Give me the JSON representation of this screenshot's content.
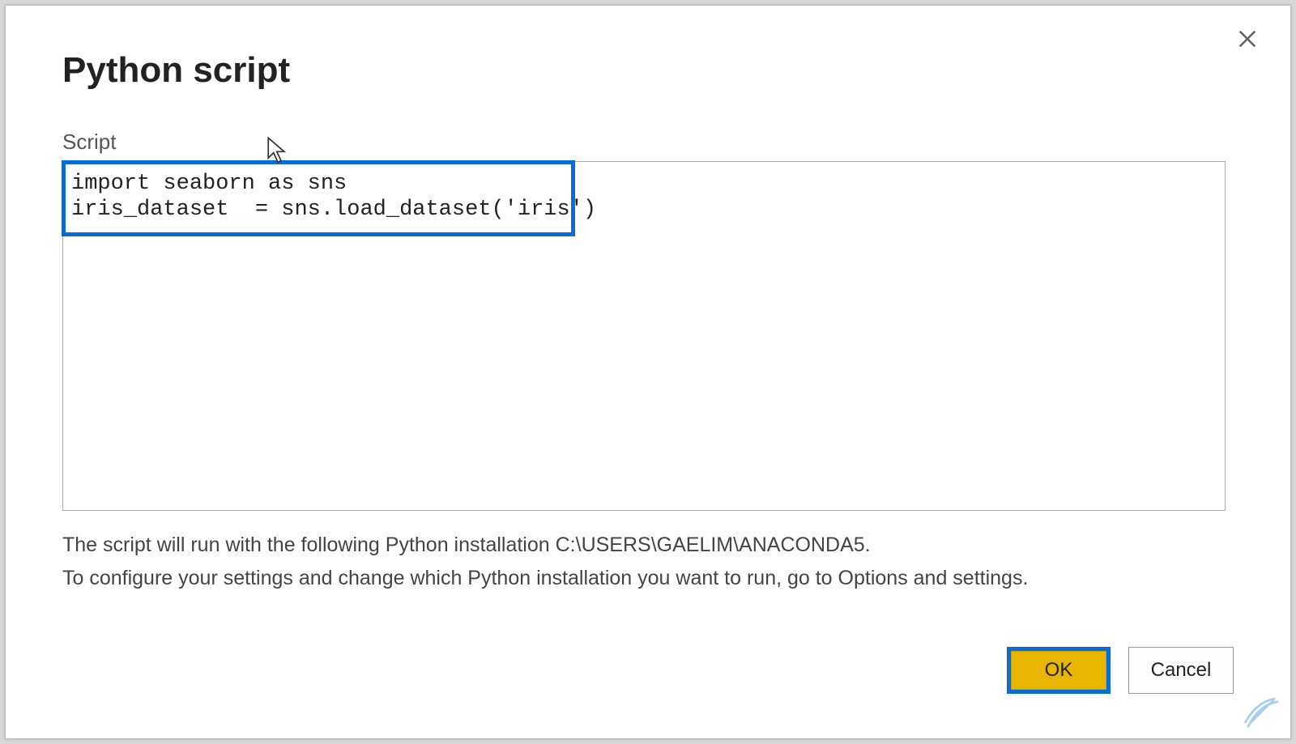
{
  "dialog": {
    "title": "Python script",
    "script_label": "Script",
    "script_content": "import seaborn as sns\niris_dataset  = sns.load_dataset('iris')",
    "info_line1": "The script will run with the following Python installation C:\\USERS\\GAELIM\\ANACONDA5.",
    "info_line2": "To configure your settings and change which Python installation you want to run, go to Options and settings.",
    "buttons": {
      "ok": "OK",
      "cancel": "Cancel"
    }
  }
}
